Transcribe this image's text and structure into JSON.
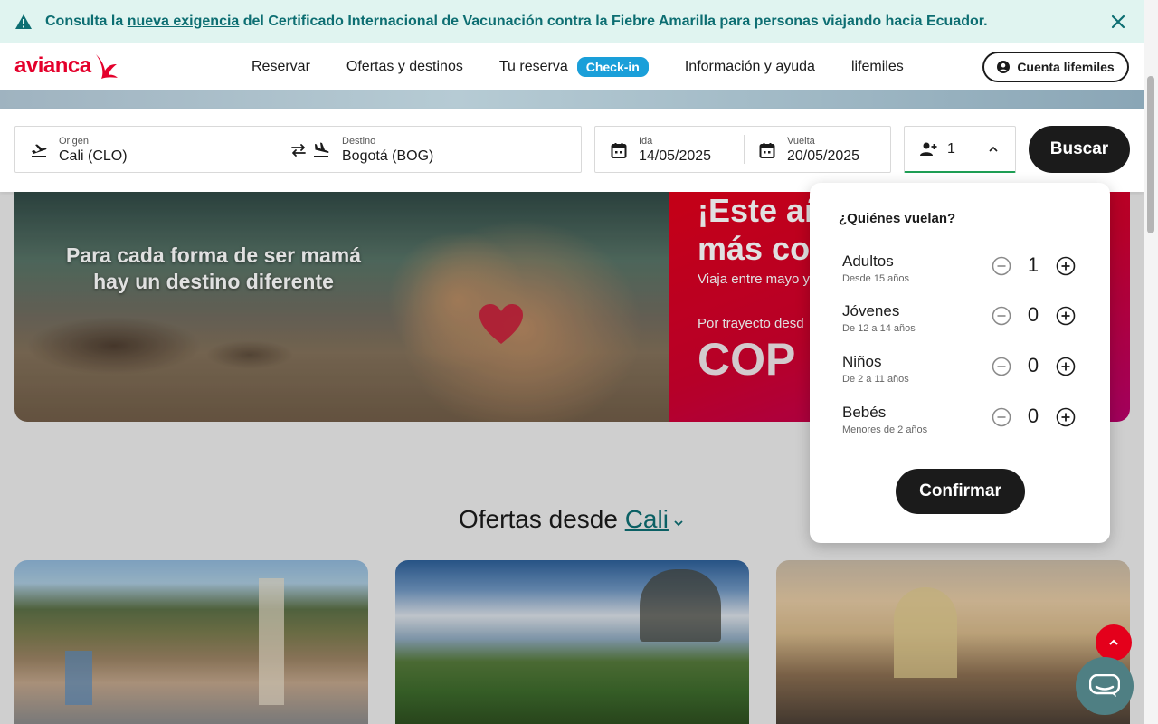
{
  "alert": {
    "text_before": "Consulta la ",
    "link": "nueva exigencia",
    "text_after": " del Certificado Internacional de Vacunación contra la Fiebre Amarilla para personas viajando hacia Ecuador."
  },
  "nav": {
    "logo": "avianca",
    "links": [
      "Reservar",
      "Ofertas y destinos",
      "Tu reserva",
      "Información y ayuda",
      "lifemiles"
    ],
    "checkin": "Check-in",
    "account": "Cuenta lifemiles"
  },
  "search": {
    "origin_label": "Origen",
    "origin_value": "Cali  (CLO)",
    "destination_label": "Destino",
    "destination_value": "Bogotá  (BOG)",
    "departure_label": "Ida",
    "departure_value": "14/05/2025",
    "return_label": "Vuelta",
    "return_value": "20/05/2025",
    "passengers_count": "1",
    "search_button": "Buscar"
  },
  "hero": {
    "tagline": "Para cada forma de ser mamá hay un destino diferente",
    "promo_title": "¡Este añ\nmás co",
    "promo_sub": "Viaja entre mayo y",
    "promo_from": "Por trayecto desd",
    "promo_price": "COP"
  },
  "offers": {
    "heading": "Ofertas desde ",
    "city": "Cali"
  },
  "passengers": {
    "title": "¿Quiénes vuelan?",
    "rows": [
      {
        "name": "Adultos",
        "age": "Desde 15 años",
        "value": "1"
      },
      {
        "name": "Jóvenes",
        "age": "De 12 a 14 años",
        "value": "0"
      },
      {
        "name": "Niños",
        "age": "De 2 a 11 años",
        "value": "0"
      },
      {
        "name": "Bebés",
        "age": "Menores de 2 años",
        "value": "0"
      }
    ],
    "confirm": "Confirmar"
  },
  "colors": {
    "brand_red": "#e4002b",
    "teal": "#0d6e72",
    "checkin_blue": "#1a9fd9",
    "dark": "#1b1b1b"
  },
  "icons": [
    "warning-icon",
    "close-icon",
    "avianca-bird-logo",
    "user-circle-icon",
    "takeoff-icon",
    "swap-icon",
    "landing-icon",
    "calendar-icon",
    "add-person-icon",
    "chevron-up-icon",
    "minus-circle-icon",
    "plus-circle-icon",
    "chevron-down-icon",
    "arrow-up-icon",
    "chat-icon"
  ]
}
